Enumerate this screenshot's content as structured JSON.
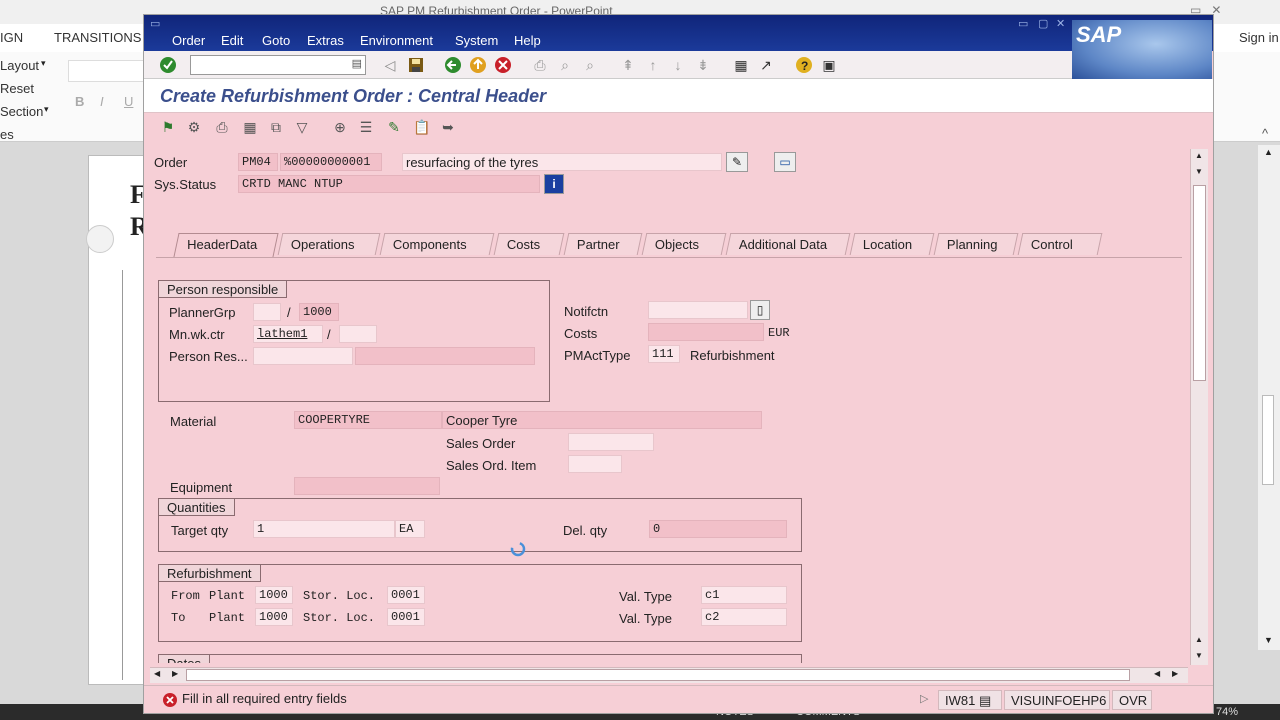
{
  "ppt": {
    "window_title": "SAP PM Refurbishment Order - PowerPoint",
    "ribbon_tabs": [
      "IGN",
      "TRANSITIONS"
    ],
    "sign_in": "Sign in",
    "commands": [
      "Layout",
      "Reset",
      "Section",
      "es"
    ],
    "font_buttons": [
      "B",
      "I",
      "U"
    ],
    "status_items": [
      "NOTES",
      "COMMENTS"
    ],
    "zoom": "74%"
  },
  "sap": {
    "menu": [
      "Order",
      "Edit",
      "Goto",
      "Extras",
      "Environment",
      "System",
      "Help"
    ],
    "logo": "SAP",
    "title": "Create Refurbishment Order : Central Header",
    "header": {
      "order_label": "Order",
      "order_type": "PM04",
      "order_number": "%00000000001",
      "order_desc": "resurfacing of the tyres",
      "sysstatus_label": "Sys.Status",
      "sysstatus_value": "CRTD MANC NTUP"
    },
    "tabs": [
      "HeaderData",
      "Operations",
      "Components",
      "Costs",
      "Partner",
      "Objects",
      "Additional Data",
      "Location",
      "Planning",
      "Control"
    ],
    "active_tab": "HeaderData",
    "person_responsible": {
      "group_title": "Person responsible",
      "plannergrp_label": "PlannerGrp",
      "plannergrp_value": "",
      "plannergrp_plant": "1000",
      "mnwkctr_label": "Mn.wk.ctr",
      "mnwkctr_value": "lathem1",
      "mnwkctr_plant": "",
      "personres_label": "Person Res..."
    },
    "right_fields": {
      "notifctn_label": "Notifctn",
      "costs_label": "Costs",
      "costs_currency": "EUR",
      "pmacttype_label": "PMActType",
      "pmacttype_value": "111",
      "pmacttype_desc": "Refurbishment"
    },
    "material": {
      "material_label": "Material",
      "material_value": "COOPERTYRE",
      "material_desc": "Cooper Tyre",
      "sales_order_label": "Sales Order",
      "sales_ord_item_label": "Sales Ord. Item",
      "equipment_label": "Equipment"
    },
    "quantities": {
      "group_title": "Quantities",
      "target_qty_label": "Target qty",
      "target_qty_value": "1",
      "target_qty_unit": "EA",
      "del_qty_label": "Del. qty",
      "del_qty_value": "0"
    },
    "refurbishment": {
      "group_title": "Refurbishment",
      "from_label": "From",
      "to_label": "To",
      "plant_label": "Plant",
      "from_plant": "1000",
      "to_plant": "1000",
      "stor_loc_label": "Stor. Loc.",
      "from_stor_loc": "0001",
      "to_stor_loc": "0001",
      "val_type_label": "Val. Type",
      "from_val_type": "c1",
      "to_val_type": "c2"
    },
    "dates": {
      "group_title": "Dates"
    },
    "status_bar": {
      "message": "Fill in all required entry fields",
      "transaction": "IW81",
      "system": "VISUINFOEHP6",
      "mode": "OVR"
    }
  }
}
